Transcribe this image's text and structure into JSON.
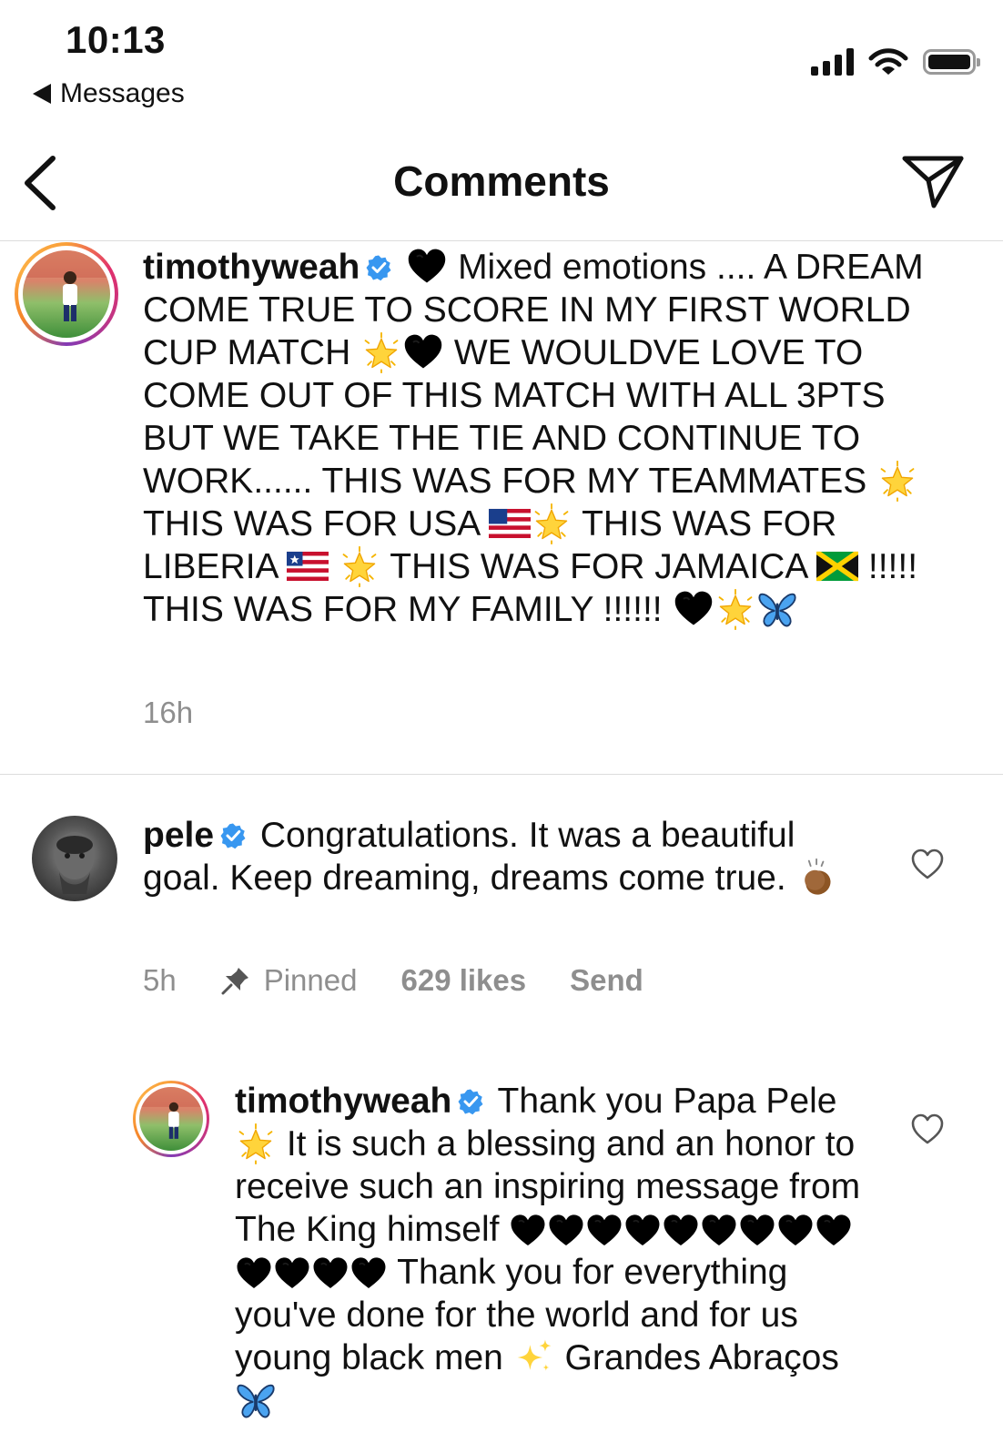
{
  "status_bar": {
    "time": "10:13",
    "back_app": "Messages"
  },
  "nav": {
    "title": "Comments"
  },
  "caption": {
    "username": "timothyweah",
    "segments": [
      "Mixed emotions .... A DREAM COME TRUE TO SCORE IN MY FIRST WORLD CUP MATCH",
      "WE WOULDVE LOVE TO COME OUT OF THIS MATCH WITH ALL 3PTS BUT WE TAKE THE TIE AND CONTINUE TO WORK...... THIS WAS FOR MY TEAMMATES",
      "THIS WAS FOR USA",
      "THIS WAS FOR LIBERIA",
      "THIS WAS FOR JAMAICA",
      "!!!!! THIS WAS FOR MY FAMILY !!!!!!"
    ],
    "time": "16h"
  },
  "comments": [
    {
      "username": "pele",
      "text": "Congratulations. It was a beautiful goal. Keep dreaming, dreams come true.",
      "time": "5h",
      "pinned_label": "Pinned",
      "likes": "629 likes",
      "send_label": "Send"
    },
    {
      "username": "timothyweah",
      "segments": [
        "Thank you Papa Pele",
        "It is such a blessing and an honor to receive such an inspiring message from The King himself",
        "Thank you for everything you've done for the world and for us young black men",
        "Grandes Abraços"
      ]
    }
  ],
  "icons": {
    "back": "chevron-left-icon",
    "share": "paper-plane-icon",
    "verified": "verified-badge-icon",
    "heart": "heart-outline-icon",
    "pin": "pin-icon"
  },
  "colors": {
    "verified": "#3897f0",
    "meta": "#8e8e8e",
    "divider": "#dcdcdc"
  }
}
